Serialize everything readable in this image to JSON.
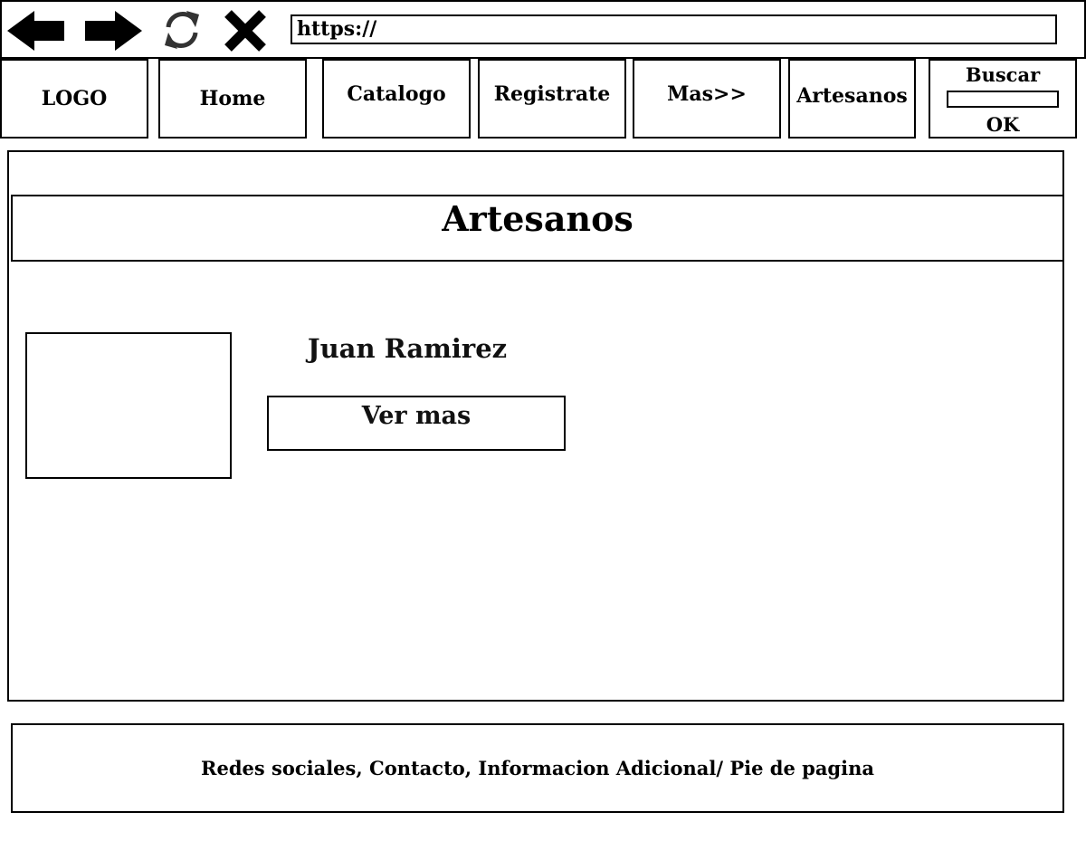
{
  "browser": {
    "url": "https://",
    "icons": {
      "back": "arrow-left-icon",
      "forward": "arrow-right-icon",
      "reload": "reload-icon",
      "stop": "close-icon"
    }
  },
  "nav": {
    "logo": "LOGO",
    "home": "Home",
    "catalog": "Catalogo",
    "register": "Registrate",
    "more": "Mas>>",
    "artisans": "Artesanos"
  },
  "search": {
    "label": "Buscar",
    "button": "OK"
  },
  "main": {
    "title": "Artesanos",
    "artisan": {
      "name": "Juan Ramirez",
      "button_label": "Ver mas"
    }
  },
  "footer": {
    "text": "Redes sociales, Contacto, Informacion Adicional/ Pie de pagina"
  }
}
